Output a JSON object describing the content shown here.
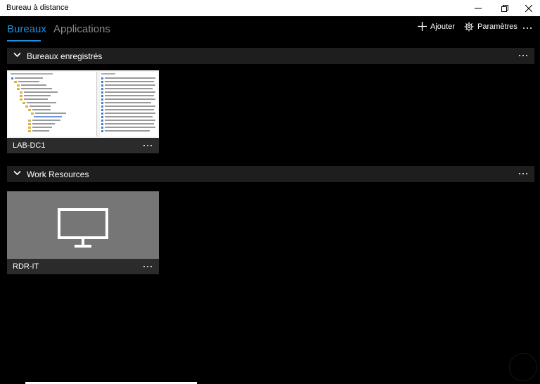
{
  "window": {
    "title": "Bureau à distance"
  },
  "tabs": [
    {
      "label": "Bureaux"
    },
    {
      "label": "Applications"
    }
  ],
  "toolbar": {
    "add_label": "Ajouter",
    "settings_label": "Paramètres"
  },
  "groups": [
    {
      "label": "Bureaux enregistrés",
      "tiles": [
        {
          "name": "LAB-DC1",
          "thumbnail": "session-screenshot"
        }
      ]
    },
    {
      "label": "Work Resources",
      "tiles": [
        {
          "name": "RDR-IT",
          "thumbnail": "monitor-icon"
        }
      ]
    }
  ],
  "colors": {
    "accent": "#1f8fdc",
    "background": "#000000",
    "group_header": "#1e1e1e",
    "tile_footer": "#2b2b2b",
    "rdp_tile": "#767676"
  },
  "icons": [
    "minimize-icon",
    "maximize-icon",
    "close-icon",
    "plus-icon",
    "gear-icon",
    "more-icon",
    "chevron-down-icon",
    "monitor-icon"
  ]
}
